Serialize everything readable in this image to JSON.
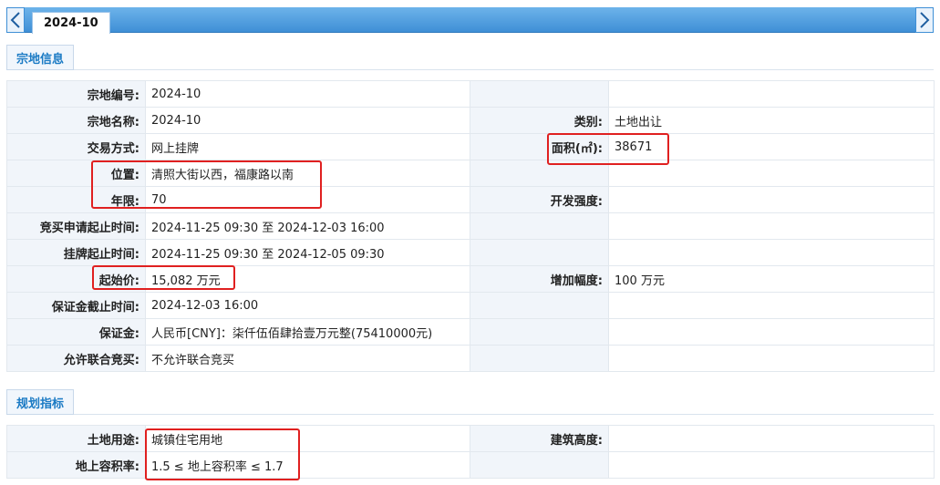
{
  "tab": {
    "title": "2024-10"
  },
  "sections": {
    "parcel": "宗地信息",
    "planning": "规划指标"
  },
  "parcel": {
    "rows": [
      {
        "l1": "宗地编号:",
        "v1": "2024-10",
        "l2": "",
        "v2": ""
      },
      {
        "l1": "宗地名称:",
        "v1": "2024-10",
        "l2": "类别:",
        "v2": "土地出让"
      },
      {
        "l1": "交易方式:",
        "v1": "网上挂牌",
        "l2": "面积(㎡):",
        "v2": "38671"
      },
      {
        "l1": "位置:",
        "v1": "清照大街以西，福康路以南",
        "l2": "",
        "v2": ""
      },
      {
        "l1": "年限:",
        "v1": "70",
        "l2": "开发强度:",
        "v2": ""
      },
      {
        "l1": "竞买申请起止时间:",
        "v1": "2024-11-25 09:30 至 2024-12-03 16:00",
        "l2": "",
        "v2": ""
      },
      {
        "l1": "挂牌起止时间:",
        "v1": "2024-11-25 09:30 至 2024-12-05 09:30",
        "l2": "",
        "v2": ""
      },
      {
        "l1": "起始价:",
        "v1": "15,082 万元",
        "l2": "增加幅度:",
        "v2": "100 万元"
      },
      {
        "l1": "保证金截止时间:",
        "v1": "2024-12-03 16:00",
        "l2": "",
        "v2": ""
      },
      {
        "l1": "保证金:",
        "v1": "人民币[CNY]：柒仟伍佰肆拾壹万元整(75410000元)",
        "l2": "",
        "v2": ""
      },
      {
        "l1": "允许联合竞买:",
        "v1": "不允许联合竞买",
        "l2": "",
        "v2": ""
      }
    ]
  },
  "planning": {
    "rows": [
      {
        "l1": "土地用途:",
        "v1": "城镇住宅用地",
        "l2": "建筑高度:",
        "v2": ""
      },
      {
        "l1": "地上容积率:",
        "v1": "1.5 ≤ 地上容积率 ≤ 1.7",
        "l2": "",
        "v2": ""
      }
    ]
  },
  "colors": {
    "accent": "#1a7ac4",
    "tabbar": "#3f8fd6",
    "highlight": "#e02020",
    "label_bg": "#f1f5fa"
  }
}
